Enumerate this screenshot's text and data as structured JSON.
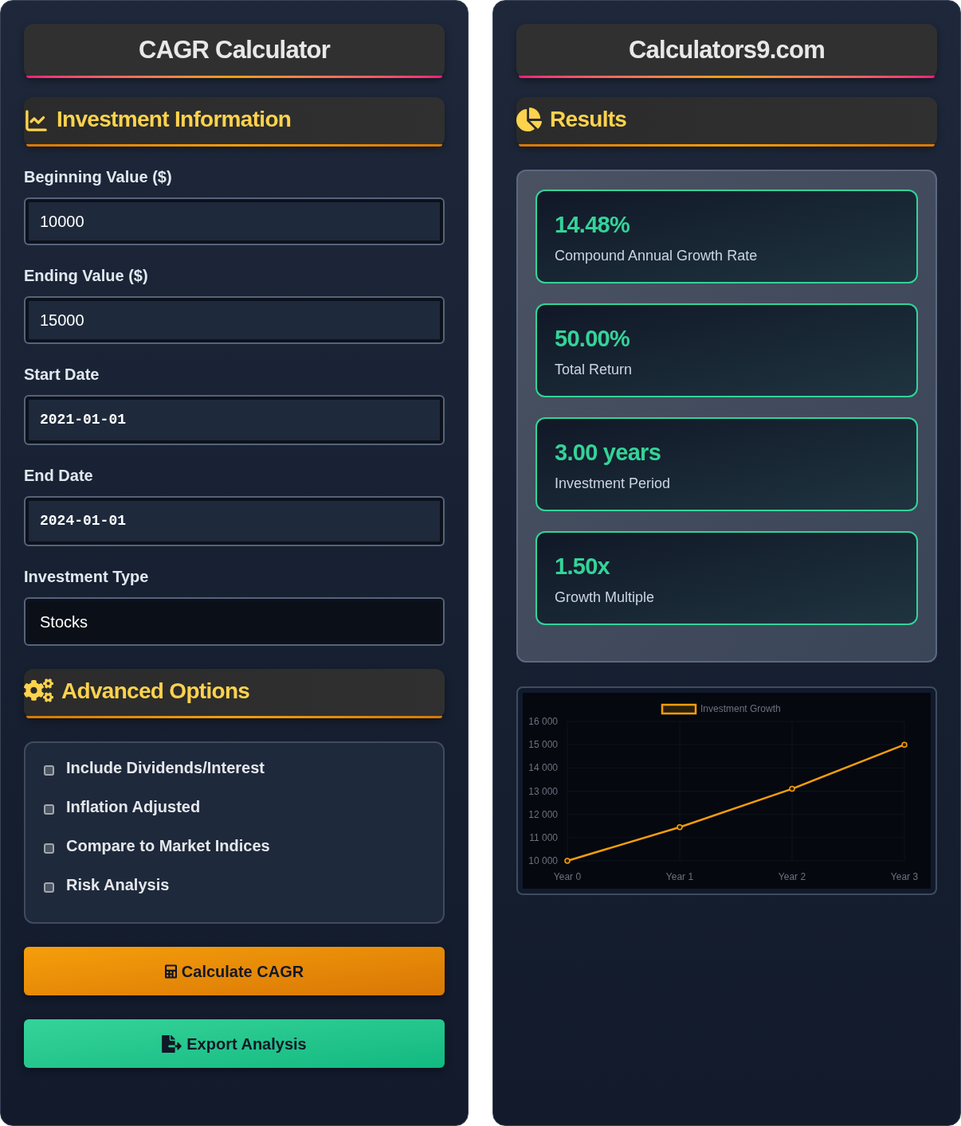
{
  "calculator_panel": {
    "title": "CAGR Calculator",
    "investment_section": {
      "heading": "Investment Information",
      "fields": [
        {
          "label": "Beginning Value ($)",
          "value": "10000",
          "kind": "number"
        },
        {
          "label": "Ending Value ($)",
          "value": "15000",
          "kind": "number"
        },
        {
          "label": "Start Date",
          "value": "2021-01-01",
          "kind": "date"
        },
        {
          "label": "End Date",
          "value": "2024-01-01",
          "kind": "date"
        },
        {
          "label": "Investment Type",
          "value": "Stocks",
          "kind": "select"
        }
      ]
    },
    "advanced_section": {
      "heading": "Advanced Options",
      "options": [
        {
          "label": "Include Dividends/Interest",
          "checked": false
        },
        {
          "label": "Inflation Adjusted",
          "checked": false
        },
        {
          "label": "Compare to Market Indices",
          "checked": false
        },
        {
          "label": "Risk Analysis",
          "checked": false
        }
      ]
    },
    "buttons": [
      {
        "label": "Calculate CAGR",
        "kind": "calculate"
      },
      {
        "label": "Export Analysis",
        "kind": "export"
      }
    ]
  },
  "results_panel": {
    "title": "Calculators9.com",
    "heading": "Results",
    "cards": [
      {
        "value": "14.48%",
        "label": "Compound Annual Growth Rate"
      },
      {
        "value": "50.00%",
        "label": "Total Return"
      },
      {
        "value": "3.00 years",
        "label": "Investment Period"
      },
      {
        "value": "1.50x",
        "label": "Growth Multiple"
      }
    ],
    "chart": {
      "chart_data": {
        "type": "line",
        "categories": [
          "Year 0",
          "Year 1",
          "Year 2",
          "Year 3"
        ],
        "series": [
          {
            "name": "Investment Growth",
            "color": "#f59e0b",
            "marker": "circle",
            "values": [
              10000,
              11450,
              13100,
              15000
            ]
          }
        ],
        "ylim": [
          10000,
          16000
        ],
        "yticks": [
          {
            "value": 10000,
            "label": "10 000"
          },
          {
            "value": 11000,
            "label": "11 000"
          },
          {
            "value": 12000,
            "label": "12 000"
          },
          {
            "value": 13000,
            "label": "13 000"
          },
          {
            "value": 14000,
            "label": "14 000"
          },
          {
            "value": 15000,
            "label": "15 000"
          },
          {
            "value": 16000,
            "label": "16 000"
          }
        ],
        "grid": true
      }
    }
  }
}
